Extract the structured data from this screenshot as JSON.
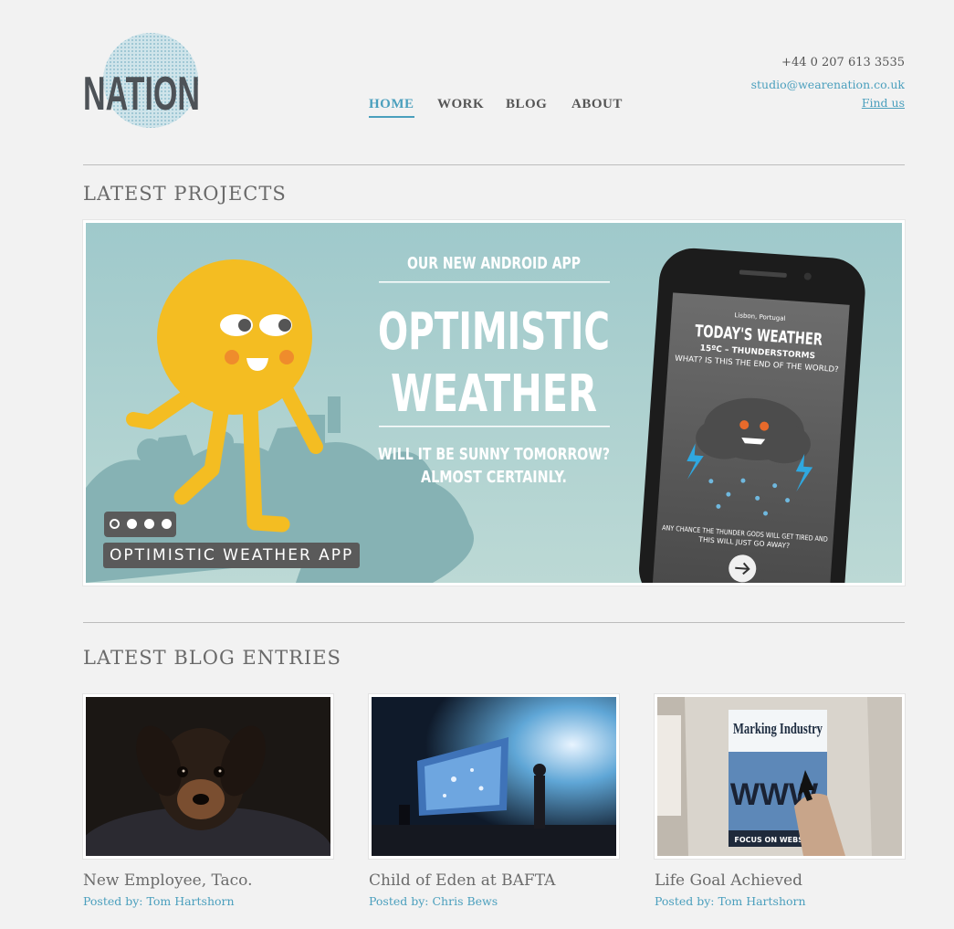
{
  "brand": {
    "logo_text": "NATION"
  },
  "nav": [
    {
      "label": "HOME",
      "active": true
    },
    {
      "label": "WORK",
      "active": false
    },
    {
      "label": "BLOG",
      "active": false
    },
    {
      "label": "ABOUT",
      "active": false
    }
  ],
  "contact": {
    "phone": "+44 0 207 613 3535",
    "email": "studio@wearenation.co.uk",
    "find_us": "Find us"
  },
  "projects": {
    "heading": "LATEST PROJECTS",
    "slide": {
      "kicker": "OUR NEW ANDROID APP",
      "title_line1": "OPTIMISTIC",
      "title_line2": "WEATHER",
      "tagline_line1": "WILL IT BE SUNNY TOMORROW?",
      "tagline_line2": "ALMOST CERTAINLY.",
      "phone_screen": {
        "location": "Lisbon, Portugal",
        "heading": "TODAY'S WEATHER",
        "condition": "15ºC – THUNDERSTORMS",
        "question": "WHAT? IS THIS THE END OF THE WORLD?",
        "footer_line1": "ANY CHANCE THE THUNDER GODS WILL GET TIRED AND",
        "footer_line2": "THIS WILL JUST GO AWAY?"
      },
      "caption": "OPTIMISTIC WEATHER APP"
    },
    "slide_count": 4,
    "current_slide": 1
  },
  "blog": {
    "heading": "LATEST BLOG ENTRIES",
    "entries": [
      {
        "title": "New Employee, Taco.",
        "author": "Posted by: Tom Hartshorn",
        "image": "dog-photo"
      },
      {
        "title": "Child of Eden at BAFTA",
        "author": "Posted by: Chris Bews",
        "image": "stage-photo"
      },
      {
        "title": "Life Goal Achieved",
        "author": "Posted by: Tom Hartshorn",
        "image": "magazine-photo",
        "image_text": {
          "masthead": "Marking Industry",
          "cover_line": "FOCUS ON WEBSITES"
        }
      }
    ]
  },
  "colors": {
    "accent": "#4a9fbd",
    "background": "#f2f2f2",
    "slide_bg": "#a9cfd1",
    "sun_yellow": "#f4bd22"
  }
}
